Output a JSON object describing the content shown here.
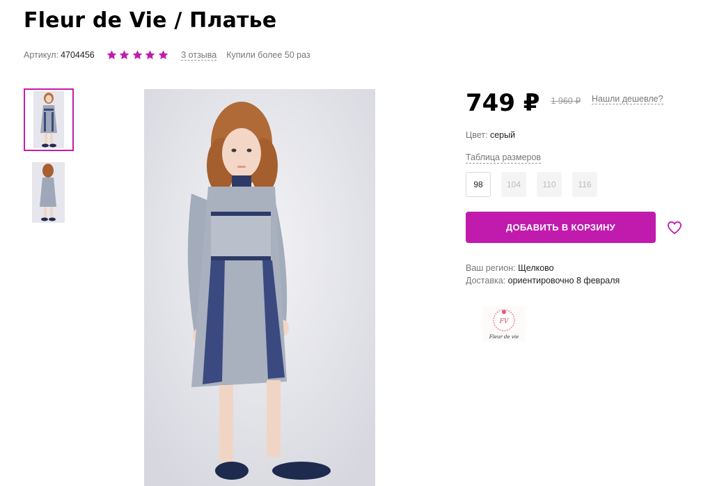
{
  "product": {
    "title": "Fleur de Vie / Платье",
    "sku_label": "Артикул:",
    "sku": "4704456",
    "rating": 5,
    "reviews": "3 отзыва",
    "bought": "Купили более 50 раз"
  },
  "gallery": {
    "thumbnails": [
      "dress-front-thumb",
      "dress-back-thumb"
    ],
    "active_index": 0
  },
  "pricing": {
    "price": "749 ₽",
    "old_price": "1 960 ₽",
    "cheaper_link": "Нашли дешевле?"
  },
  "color": {
    "label": "Цвет:",
    "value": "серый"
  },
  "size_table_link": "Таблица размеров",
  "sizes": [
    {
      "label": "98",
      "available": true
    },
    {
      "label": "104",
      "available": false
    },
    {
      "label": "110",
      "available": false
    },
    {
      "label": "116",
      "available": false
    }
  ],
  "cart_button": "ДОБАВИТЬ В КОРЗИНУ",
  "delivery": {
    "region_label": "Ваш регион:",
    "region": "Щелково",
    "delivery_label": "Доставка:",
    "delivery_value": "ориентировочно 8 февраля"
  },
  "brand_logo": {
    "text": "Fleur de vie",
    "monogram": "FV"
  },
  "colors": {
    "accent": "#c11bae",
    "muted": "#777777"
  }
}
